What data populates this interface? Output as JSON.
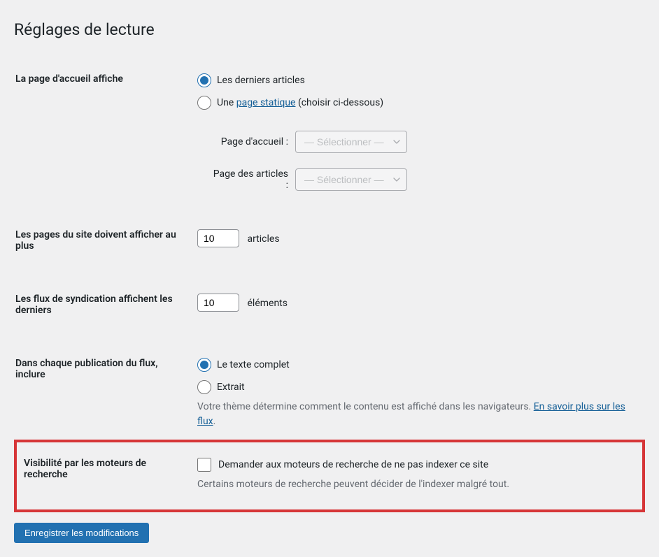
{
  "page": {
    "title": "Réglages de lecture"
  },
  "homepage": {
    "label": "La page d'accueil affiche",
    "options": {
      "latest": "Les derniers articles",
      "static_prefix": "Une ",
      "static_link": "page statique",
      "static_suffix": " (choisir ci-dessous)"
    },
    "homepage_select": {
      "label": "Page d'accueil :",
      "placeholder": "— Sélectionner —"
    },
    "posts_select": {
      "label": "Page des articles :",
      "placeholder": "— Sélectionner —"
    }
  },
  "posts_per_page": {
    "label": "Les pages du site doivent afficher au plus",
    "value": "10",
    "suffix": "articles"
  },
  "feed_items": {
    "label": "Les flux de syndication affichent les derniers",
    "value": "10",
    "suffix": "éléments"
  },
  "feed_content": {
    "label": "Dans chaque publication du flux, inclure",
    "options": {
      "full": "Le texte complet",
      "excerpt": "Extrait"
    },
    "description_prefix": "Votre thème détermine comment le contenu est affiché dans les navigateurs. ",
    "description_link": "En savoir plus sur les flux",
    "description_suffix": "."
  },
  "visibility": {
    "label": "Visibilité par les moteurs de recherche",
    "checkbox_label": "Demander aux moteurs de recherche de ne pas indexer ce site",
    "description": "Certains moteurs de recherche peuvent décider de l'indexer malgré tout."
  },
  "submit": {
    "label": "Enregistrer les modifications"
  }
}
